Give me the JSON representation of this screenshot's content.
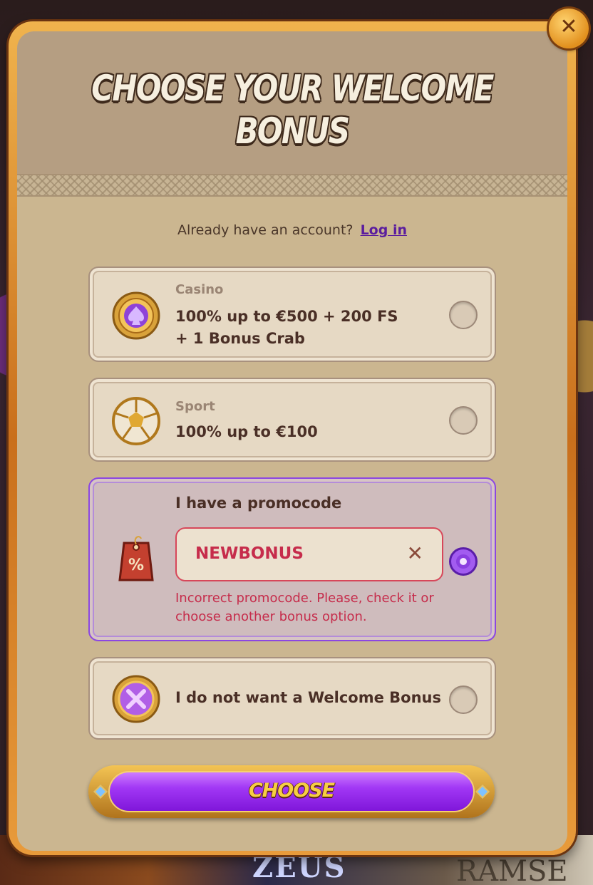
{
  "modal": {
    "title_line1": "Choose your welcome",
    "title_line2": "bonus",
    "close_label": "✕"
  },
  "account": {
    "prompt": "Already have an account?",
    "login_link": "Log in"
  },
  "options": [
    {
      "category": "Casino",
      "desc_line1": "100% up to €500 + 200 FS",
      "desc_line2": "+ 1 Bonus Crab",
      "icon": "casino-spade-coin-icon",
      "selected": false
    },
    {
      "category": "Sport",
      "desc_line1": "100% up to €100",
      "icon": "soccer-ball-icon",
      "selected": false
    },
    {
      "category": "I have a promocode",
      "icon": "percent-tag-icon",
      "input_value": "NEWBONUS",
      "clear_label": "✕",
      "error": "Incorrect promocode. Please, check it or choose another bonus option.",
      "selected": true
    },
    {
      "desc_line1": "I do not want a Welcome Bonus",
      "icon": "no-bonus-x-coin-icon",
      "selected": false
    }
  ],
  "actions": {
    "choose_label": "CHOOSE"
  },
  "background": {
    "game_title_1": "ZEUS",
    "game_title_2": "RAMSE"
  },
  "colors": {
    "accent_purple": "#8c47e2",
    "error_red": "#c62c4b",
    "gold": "#f6ce43"
  }
}
